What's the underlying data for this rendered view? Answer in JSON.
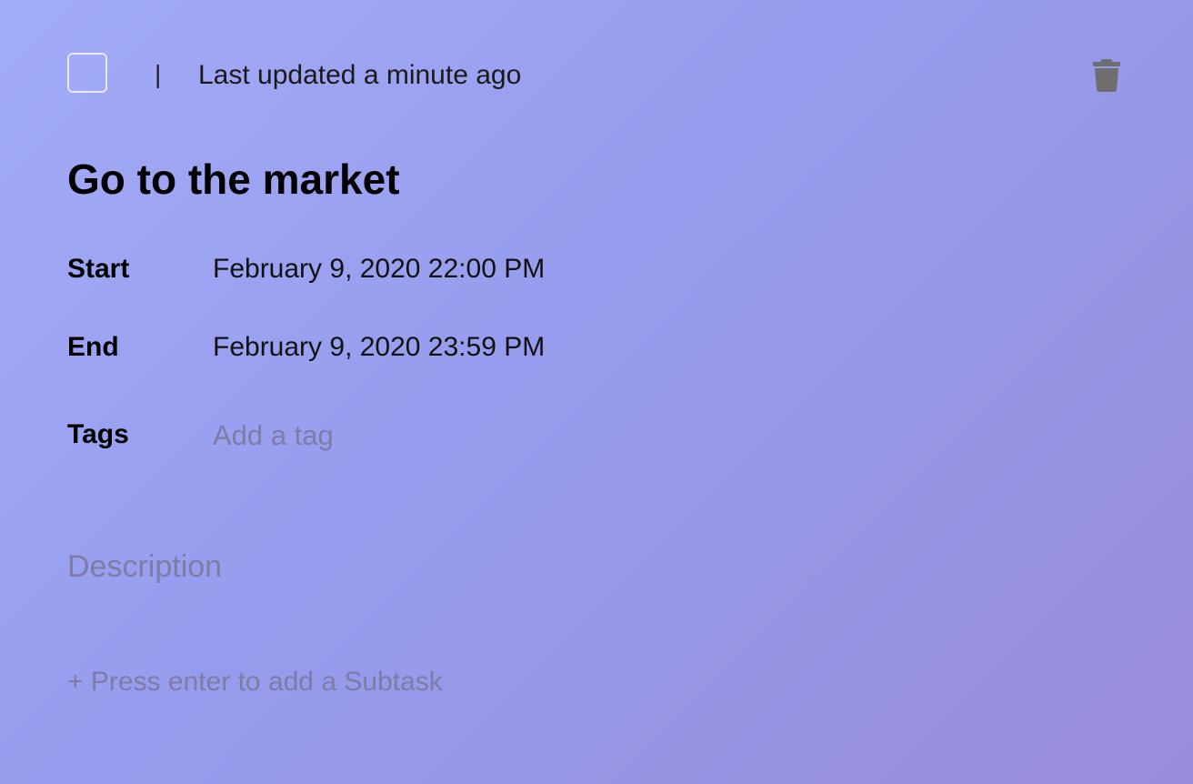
{
  "header": {
    "separator": "|",
    "last_updated": "Last updated a minute ago",
    "delete_icon": "trash-icon"
  },
  "task": {
    "title": "Go to the market",
    "completed": false
  },
  "fields": {
    "start": {
      "label": "Start",
      "value": "February 9, 2020 22:00 PM"
    },
    "end": {
      "label": "End",
      "value": "February 9, 2020 23:59 PM"
    },
    "tags": {
      "label": "Tags",
      "placeholder": "Add a tag"
    }
  },
  "description": {
    "placeholder": "Description"
  },
  "subtask": {
    "placeholder": "+ Press enter to add a Subtask"
  }
}
